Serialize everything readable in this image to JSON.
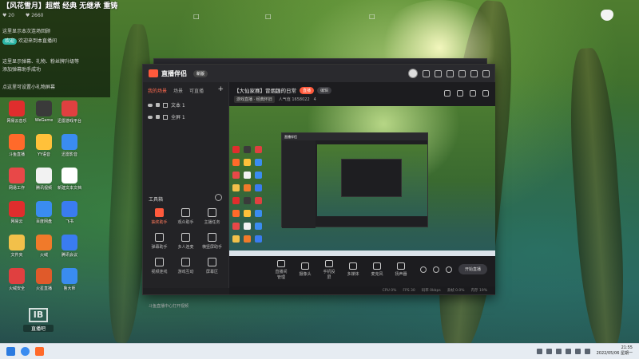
{
  "overlay": {
    "title": "【风花雪月】超燃 经典 无继承 重铸",
    "stats": [
      "♥ 20",
      "♥ 2660"
    ],
    "lines": [
      "这里显示本次连场回顾",
      "这里显示本次开播欢迎",
      "这里显示弹幕、礼物、粉丝牌升级等",
      "添加弹幕助手成功",
      "点这里可设置小礼物屏幕"
    ],
    "badge": "欢迎",
    "badge_text": "欢迎来到本直播间"
  },
  "desktop_icons": [
    {
      "label": "网易云音乐",
      "color": "#e02d2d"
    },
    {
      "label": "WeGame",
      "color": "#3a3a3a"
    },
    {
      "label": "迅雷游戏平台",
      "color": "#e04040"
    },
    {
      "label": "斗鱼直播",
      "color": "#ff6a2a"
    },
    {
      "label": "YY语音",
      "color": "#ffc13a"
    },
    {
      "label": "迅雷影音",
      "color": "#3a8cf0"
    },
    {
      "label": "网易工作",
      "color": "#e84848"
    },
    {
      "label": "腾讯视频",
      "color": "#f2f2f2"
    },
    {
      "label": "新建文本文档",
      "color": "#ffffff"
    },
    {
      "label": "网易云",
      "color": "#e02d2d"
    },
    {
      "label": "百度网盘",
      "color": "#3a8cf0"
    },
    {
      "label": "飞书",
      "color": "#3a7cf0"
    },
    {
      "label": "文件夹",
      "color": "#f2c04a"
    },
    {
      "label": "火绒",
      "color": "#f07a2a"
    },
    {
      "label": "腾讯会议",
      "color": "#3a7cf0"
    },
    {
      "label": "火绒安全",
      "color": "#e04040"
    },
    {
      "label": "火星直播",
      "color": "#e05a2a"
    },
    {
      "label": "鲁大师",
      "color": "#3a8cf0"
    }
  ],
  "app": {
    "name": "直播伴侣",
    "tag": "新版",
    "tabs": [
      "我的场景",
      "场景",
      "可直播"
    ],
    "scenes": [
      "文本 1",
      "全屏 1"
    ],
    "tools_label": "工具箱",
    "tools": [
      "抽奖助手",
      "观众助手",
      "主播任务",
      "弹幕助手",
      "多人连麦",
      "横竖屏助手",
      "视频连线",
      "游戏互动",
      "屏幕区"
    ],
    "footer": "斗鱼直播中心打开视频",
    "room_title": "【大仙家赛】冒烟趣的日常",
    "room_live": "直播",
    "room_btn": "编辑",
    "room_sub": [
      "游戏直播 · 经典怀旧",
      "人气值 1658022",
      "4"
    ],
    "controls": [
      "直播间管理",
      "摄像头",
      "手机投屏",
      "多媒体",
      "麦克风",
      "扬声器"
    ],
    "start": "开始直播",
    "status": [
      "CPU 0%",
      "FPS 30",
      "码率 0kbps",
      "丢帧 0.0%",
      "内存 19%"
    ]
  },
  "watermark": {
    "text": "IB",
    "sub": "直播吧"
  },
  "taskbar": {
    "time": "21:55",
    "date": "2022/05/06 星期一"
  }
}
